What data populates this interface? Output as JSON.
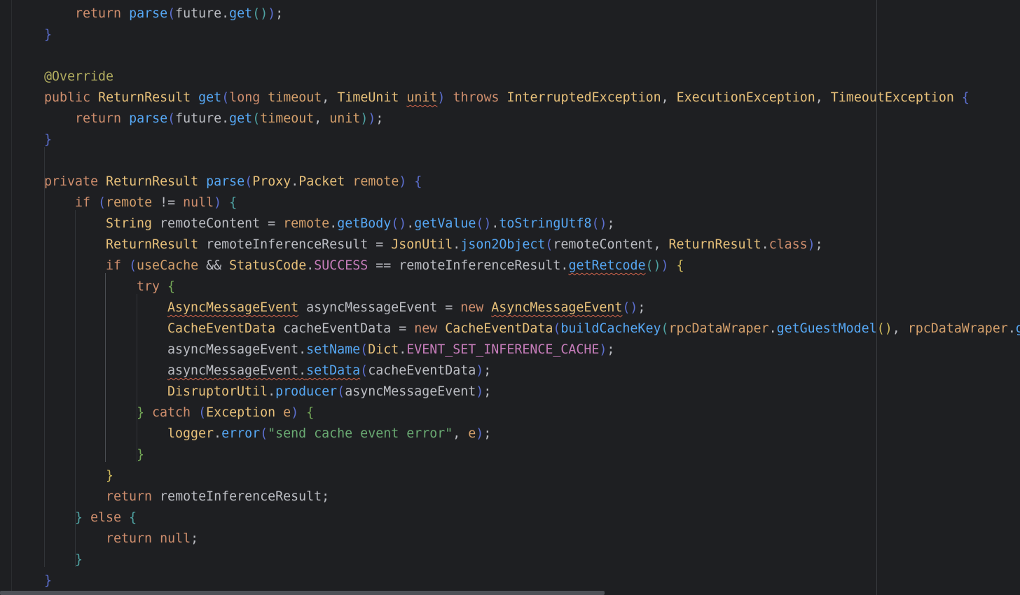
{
  "editor": {
    "colors": {
      "background": "#1e1f22",
      "keyword": "#cf8e6d",
      "type": "#e8c17a",
      "method": "#56a8f5",
      "param": "#d5a06b",
      "constant": "#c77dbb",
      "string": "#6aab73",
      "annotation": "#b3ae60",
      "text": "#bcbec4",
      "warning_underline": "#d3654b"
    },
    "lines": [
      {
        "indent": 2,
        "tokens": [
          [
            "return",
            "keyword"
          ],
          [
            " ",
            "default"
          ],
          [
            "parse",
            "method"
          ],
          [
            "(",
            "paren1"
          ],
          [
            "future",
            "default"
          ],
          [
            ".",
            "default"
          ],
          [
            "get",
            "method"
          ],
          [
            "(",
            "paren2"
          ],
          [
            ")",
            "paren2"
          ],
          [
            ")",
            "paren1"
          ],
          [
            ";",
            "default"
          ]
        ]
      },
      {
        "indent": 1,
        "tokens": [
          [
            "}",
            "brace1"
          ]
        ]
      },
      {
        "indent": 0,
        "tokens": []
      },
      {
        "indent": 1,
        "tokens": [
          [
            "@Override",
            "annotation"
          ]
        ]
      },
      {
        "indent": 1,
        "tokens": [
          [
            "public",
            "keyword"
          ],
          [
            " ",
            "default"
          ],
          [
            "ReturnResult",
            "type"
          ],
          [
            " ",
            "default"
          ],
          [
            "get",
            "method"
          ],
          [
            "(",
            "paren1"
          ],
          [
            "long",
            "keyword"
          ],
          [
            " ",
            "default"
          ],
          [
            "timeout",
            "param"
          ],
          [
            ", ",
            "default"
          ],
          [
            "TimeUnit",
            "type"
          ],
          [
            " ",
            "default"
          ],
          [
            "unit",
            "param",
            "warn"
          ],
          [
            ")",
            "paren1"
          ],
          [
            " ",
            "default"
          ],
          [
            "throws",
            "keyword"
          ],
          [
            " ",
            "default"
          ],
          [
            "InterruptedException",
            "type"
          ],
          [
            ", ",
            "default"
          ],
          [
            "ExecutionException",
            "type"
          ],
          [
            ", ",
            "default"
          ],
          [
            "TimeoutException",
            "type"
          ],
          [
            " ",
            "default"
          ],
          [
            "{",
            "brace1"
          ]
        ]
      },
      {
        "indent": 2,
        "tokens": [
          [
            "return",
            "keyword"
          ],
          [
            " ",
            "default"
          ],
          [
            "parse",
            "method"
          ],
          [
            "(",
            "paren1"
          ],
          [
            "future",
            "default"
          ],
          [
            ".",
            "default"
          ],
          [
            "get",
            "method"
          ],
          [
            "(",
            "paren2"
          ],
          [
            "timeout",
            "param"
          ],
          [
            ", ",
            "default"
          ],
          [
            "unit",
            "param"
          ],
          [
            ")",
            "paren2"
          ],
          [
            ")",
            "paren1"
          ],
          [
            ";",
            "default"
          ]
        ]
      },
      {
        "indent": 1,
        "tokens": [
          [
            "}",
            "brace1"
          ]
        ]
      },
      {
        "indent": 0,
        "tokens": []
      },
      {
        "indent": 1,
        "tokens": [
          [
            "private",
            "keyword"
          ],
          [
            " ",
            "default"
          ],
          [
            "ReturnResult",
            "type"
          ],
          [
            " ",
            "default"
          ],
          [
            "parse",
            "method"
          ],
          [
            "(",
            "paren1"
          ],
          [
            "Proxy",
            "type"
          ],
          [
            ".",
            "default"
          ],
          [
            "Packet",
            "type"
          ],
          [
            " ",
            "default"
          ],
          [
            "remote",
            "param"
          ],
          [
            ")",
            "paren1"
          ],
          [
            " ",
            "default"
          ],
          [
            "{",
            "brace1"
          ]
        ]
      },
      {
        "indent": 2,
        "tokens": [
          [
            "if",
            "keyword"
          ],
          [
            " ",
            "default"
          ],
          [
            "(",
            "paren1"
          ],
          [
            "remote",
            "param"
          ],
          [
            " != ",
            "default"
          ],
          [
            "null",
            "keyword"
          ],
          [
            ")",
            "paren1"
          ],
          [
            " ",
            "default"
          ],
          [
            "{",
            "brace2"
          ]
        ]
      },
      {
        "indent": 3,
        "tokens": [
          [
            "String",
            "type"
          ],
          [
            " remoteContent = ",
            "default"
          ],
          [
            "remote",
            "param"
          ],
          [
            ".",
            "default"
          ],
          [
            "getBody",
            "method"
          ],
          [
            "()",
            "paren1"
          ],
          [
            ".",
            "default"
          ],
          [
            "getValue",
            "method"
          ],
          [
            "()",
            "paren1"
          ],
          [
            ".",
            "default"
          ],
          [
            "toStringUtf8",
            "method"
          ],
          [
            "()",
            "paren1"
          ],
          [
            ";",
            "default"
          ]
        ]
      },
      {
        "indent": 3,
        "tokens": [
          [
            "ReturnResult",
            "type"
          ],
          [
            " remoteInferenceResult = ",
            "default"
          ],
          [
            "JsonUtil",
            "type"
          ],
          [
            ".",
            "default"
          ],
          [
            "json2Object",
            "method"
          ],
          [
            "(",
            "paren1"
          ],
          [
            "remoteContent, ",
            "default"
          ],
          [
            "ReturnResult",
            "type"
          ],
          [
            ".",
            "default"
          ],
          [
            "class",
            "keyword"
          ],
          [
            ")",
            "paren1"
          ],
          [
            ";",
            "default"
          ]
        ]
      },
      {
        "indent": 3,
        "tokens": [
          [
            "if",
            "keyword"
          ],
          [
            " ",
            "default"
          ],
          [
            "(",
            "paren1"
          ],
          [
            "useCache",
            "param"
          ],
          [
            " && ",
            "default"
          ],
          [
            "StatusCode",
            "type"
          ],
          [
            ".",
            "default"
          ],
          [
            "SUCCESS",
            "const"
          ],
          [
            " == remoteInferenceResult.",
            "default"
          ],
          [
            "getRetcode",
            "method",
            "warn"
          ],
          [
            "()",
            "paren2"
          ],
          [
            ")",
            "paren1"
          ],
          [
            " ",
            "default"
          ],
          [
            "{",
            "brace3"
          ]
        ]
      },
      {
        "indent": 4,
        "tokens": [
          [
            "try",
            "keyword"
          ],
          [
            " ",
            "default"
          ],
          [
            "{",
            "brace4"
          ]
        ]
      },
      {
        "indent": 5,
        "tokens": [
          [
            "AsyncMessageEvent",
            "type",
            "warn"
          ],
          [
            " asyncMessageEvent = ",
            "default"
          ],
          [
            "new",
            "keyword"
          ],
          [
            " ",
            "default"
          ],
          [
            "AsyncMessageEvent",
            "type",
            "warn"
          ],
          [
            "()",
            "paren1"
          ],
          [
            ";",
            "default"
          ]
        ]
      },
      {
        "indent": 5,
        "tokens": [
          [
            "CacheEventData",
            "type"
          ],
          [
            " cacheEventData = ",
            "default"
          ],
          [
            "new",
            "keyword"
          ],
          [
            " ",
            "default"
          ],
          [
            "CacheEventData",
            "type"
          ],
          [
            "(",
            "paren1"
          ],
          [
            "buildCacheKey",
            "method"
          ],
          [
            "(",
            "paren2"
          ],
          [
            "rpcDataWraper",
            "param"
          ],
          [
            ".",
            "default"
          ],
          [
            "getGuestModel",
            "method"
          ],
          [
            "()",
            "paren3"
          ],
          [
            ", ",
            "default"
          ],
          [
            "rpcDataWraper",
            "param"
          ],
          [
            ".",
            "default"
          ],
          [
            "g",
            "method"
          ]
        ]
      },
      {
        "indent": 5,
        "tokens": [
          [
            "asyncMessageEvent.",
            "default"
          ],
          [
            "setName",
            "method"
          ],
          [
            "(",
            "paren1"
          ],
          [
            "Dict",
            "type"
          ],
          [
            ".",
            "default"
          ],
          [
            "EVENT_SET_INFERENCE_CACHE",
            "const"
          ],
          [
            ")",
            "paren1"
          ],
          [
            ";",
            "default"
          ]
        ]
      },
      {
        "indent": 5,
        "tokens": [
          [
            "asyncMessageEvent",
            "default",
            "warn"
          ],
          [
            ".",
            "default",
            "warn"
          ],
          [
            "setData",
            "method",
            "warn"
          ],
          [
            "(",
            "paren1"
          ],
          [
            "cacheEventData",
            "default"
          ],
          [
            ")",
            "paren1"
          ],
          [
            ";",
            "default"
          ]
        ]
      },
      {
        "indent": 5,
        "tokens": [
          [
            "DisruptorUtil",
            "type"
          ],
          [
            ".",
            "default"
          ],
          [
            "producer",
            "method"
          ],
          [
            "(",
            "paren1"
          ],
          [
            "asyncMessageEvent",
            "default"
          ],
          [
            ")",
            "paren1"
          ],
          [
            ";",
            "default"
          ]
        ]
      },
      {
        "indent": 4,
        "tokens": [
          [
            "}",
            "brace4"
          ],
          [
            " ",
            "default"
          ],
          [
            "catch",
            "keyword"
          ],
          [
            " ",
            "default"
          ],
          [
            "(",
            "paren1"
          ],
          [
            "Exception",
            "type"
          ],
          [
            " ",
            "default"
          ],
          [
            "e",
            "param"
          ],
          [
            ")",
            "paren1"
          ],
          [
            " ",
            "default"
          ],
          [
            "{",
            "brace4"
          ]
        ]
      },
      {
        "indent": 5,
        "tokens": [
          [
            "logger",
            "type"
          ],
          [
            ".",
            "default"
          ],
          [
            "error",
            "method"
          ],
          [
            "(",
            "paren1"
          ],
          [
            "\"send cache event error\"",
            "string"
          ],
          [
            ", ",
            "default"
          ],
          [
            "e",
            "param"
          ],
          [
            ")",
            "paren1"
          ],
          [
            ";",
            "default"
          ]
        ]
      },
      {
        "indent": 4,
        "tokens": [
          [
            "}",
            "brace4"
          ]
        ]
      },
      {
        "indent": 3,
        "tokens": [
          [
            "}",
            "brace3"
          ]
        ]
      },
      {
        "indent": 3,
        "tokens": [
          [
            "return",
            "keyword"
          ],
          [
            " remoteInferenceResult;",
            "default"
          ]
        ]
      },
      {
        "indent": 2,
        "tokens": [
          [
            "}",
            "brace2"
          ],
          [
            " ",
            "default"
          ],
          [
            "else",
            "keyword"
          ],
          [
            " ",
            "default"
          ],
          [
            "{",
            "brace2"
          ]
        ]
      },
      {
        "indent": 3,
        "tokens": [
          [
            "return",
            "keyword"
          ],
          [
            " ",
            "default"
          ],
          [
            "null",
            "keyword"
          ],
          [
            ";",
            "default"
          ]
        ]
      },
      {
        "indent": 2,
        "tokens": [
          [
            "}",
            "brace2"
          ]
        ]
      },
      {
        "indent": 1,
        "tokens": [
          [
            "}",
            "brace1"
          ]
        ]
      }
    ]
  }
}
